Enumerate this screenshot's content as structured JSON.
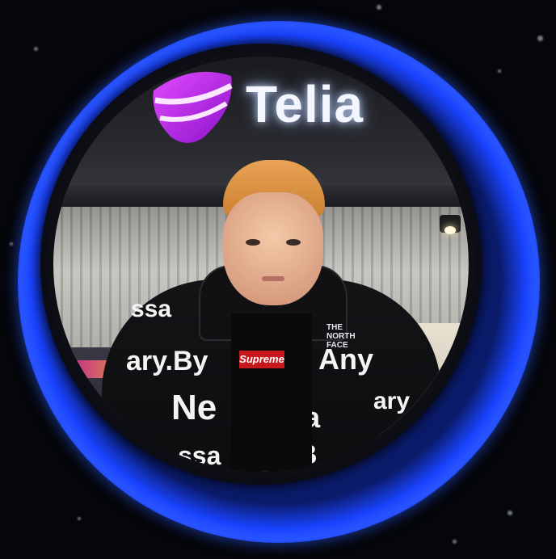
{
  "scene": {
    "store_sign": "Telia",
    "shirt_logo": "Supreme",
    "jacket_brand": "THE NORTH FACE",
    "jacket_print": [
      "ssa",
      "ary.By",
      "Any",
      "Ne",
      "essa",
      "ary",
      "ssa",
      "y.",
      "B"
    ]
  },
  "colors": {
    "ring_blue": "#1a44ff",
    "background": "#05060a",
    "logo_purple": "#b41ee0",
    "hair": "#e9a355"
  }
}
